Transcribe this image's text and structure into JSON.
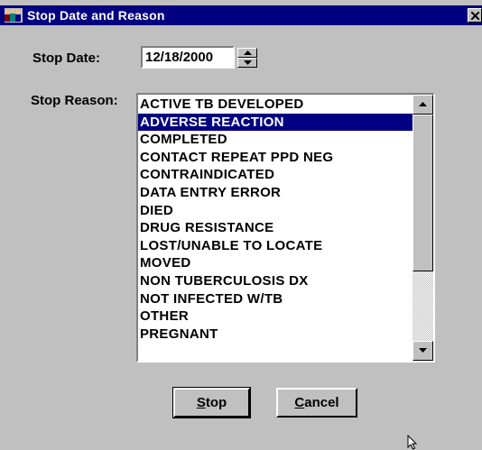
{
  "window": {
    "title": "Stop Date and Reason",
    "icon": "app-people-icon",
    "close": "close-icon"
  },
  "stop_date": {
    "label": "Stop Date:",
    "value": "12/18/2000"
  },
  "stop_reason": {
    "label": "Stop Reason:",
    "selected": "ADVERSE REACTION",
    "items": [
      "ACTIVE TB DEVELOPED",
      "ADVERSE REACTION",
      "COMPLETED",
      "CONTACT REPEAT PPD NEG",
      "CONTRAINDICATED",
      "DATA ENTRY ERROR",
      "DIED",
      "DRUG RESISTANCE",
      "LOST/UNABLE TO LOCATE",
      "MOVED",
      "NON TUBERCULOSIS DX",
      "NOT INFECTED W/TB",
      "OTHER",
      "PREGNANT"
    ]
  },
  "buttons": {
    "stop": {
      "mnemonic": "S",
      "rest": "top"
    },
    "cancel": {
      "mnemonic": "C",
      "rest": "ancel"
    }
  },
  "colors": {
    "title_bar": "#000080",
    "selection": "#000080",
    "face": "#c0c0c0"
  }
}
